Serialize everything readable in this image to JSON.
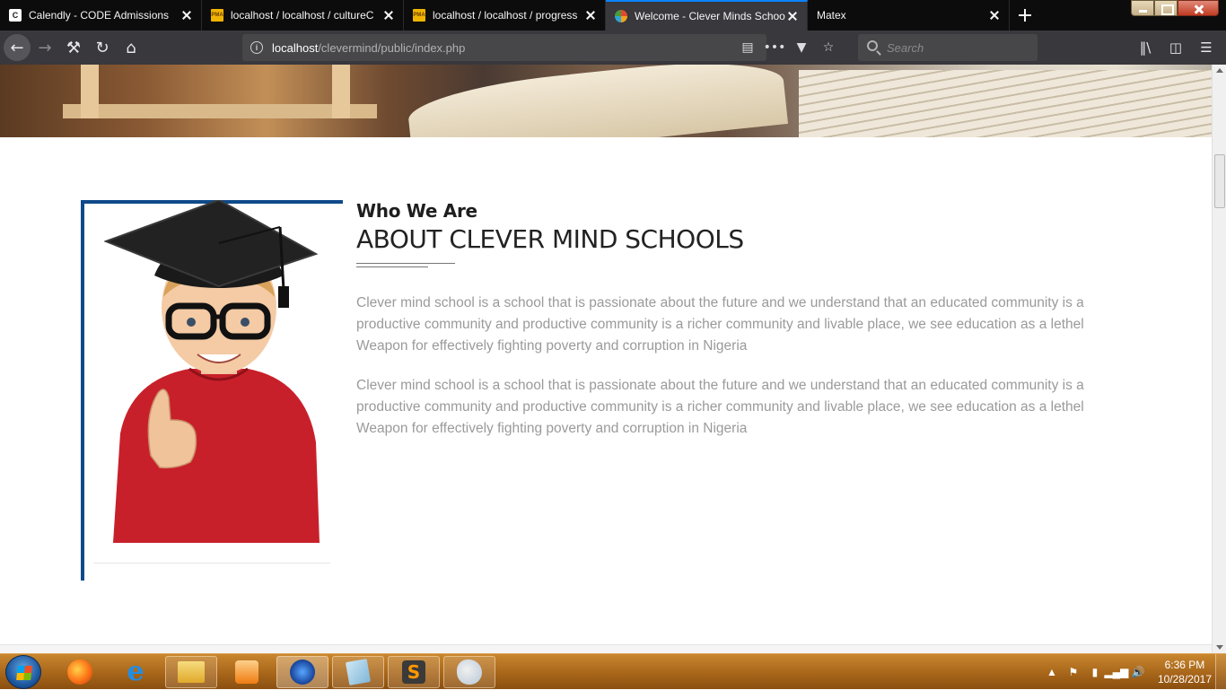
{
  "browser": {
    "tabs": [
      {
        "title": "Calendly - CODE Admissions",
        "favicon": "calendly-icon",
        "active": false
      },
      {
        "title": "localhost / localhost / cultureC",
        "favicon": "phpmyadmin-icon",
        "active": false
      },
      {
        "title": "localhost / localhost / progress",
        "favicon": "phpmyadmin-icon",
        "active": false
      },
      {
        "title": "Welcome - Clever Minds School",
        "favicon": "clever-minds-icon",
        "active": true
      },
      {
        "title": "Matex",
        "favicon": "",
        "active": false
      }
    ],
    "url": {
      "host": "localhost",
      "path": "/clevermind/public/index.php"
    },
    "search_placeholder": "Search",
    "accent_color": "#0a84ff"
  },
  "page": {
    "subtitle": "Who We Are",
    "title": "ABOUT CLEVER MIND SCHOOLS",
    "paragraphs": [
      "Clever mind school is a school that is passionate about the future and we understand that an educated community is a productive community and productive community is a richer community and livable place, we see education as a lethel Weapon for effectively fighting poverty and corruption in Nigeria",
      "Clever mind school is a school that is passionate about the future and we understand that an educated community is a productive community and productive community is a richer community and livable place, we see education as a lethel Weapon for effectively fighting poverty and corruption in Nigeria"
    ],
    "frame_color": "#0f4a8a",
    "text_color": "#9a9a9a"
  },
  "taskbar": {
    "apps": [
      "firefox-icon",
      "internet-explorer-icon",
      "file-explorer-icon",
      "media-player-icon",
      "firefox-developer-icon",
      "notes-icon",
      "sublime-text-icon",
      "paint-icon"
    ],
    "clock": {
      "time": "6:36 PM",
      "date": "10/28/2017"
    }
  }
}
